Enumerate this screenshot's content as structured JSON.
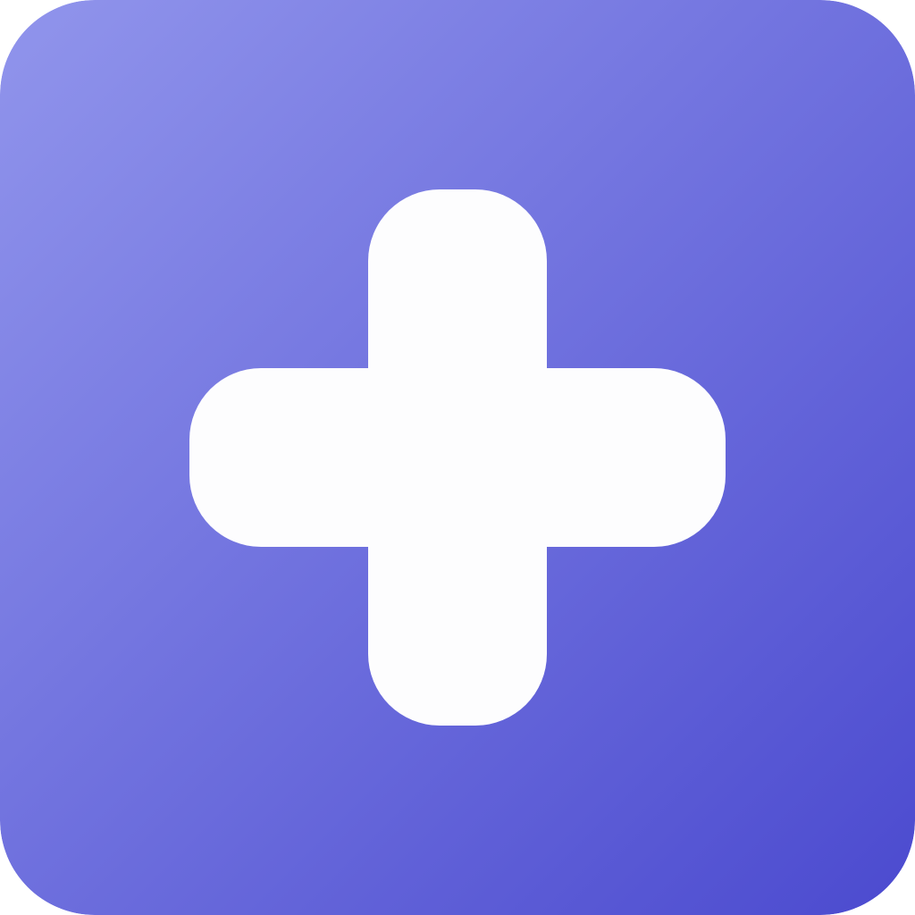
{
  "icon": {
    "symbol": "plus-icon",
    "colors": {
      "gradient_start": "#9195ec",
      "gradient_end": "#4b4acf",
      "symbol_fill": "#fdfdfe"
    }
  }
}
